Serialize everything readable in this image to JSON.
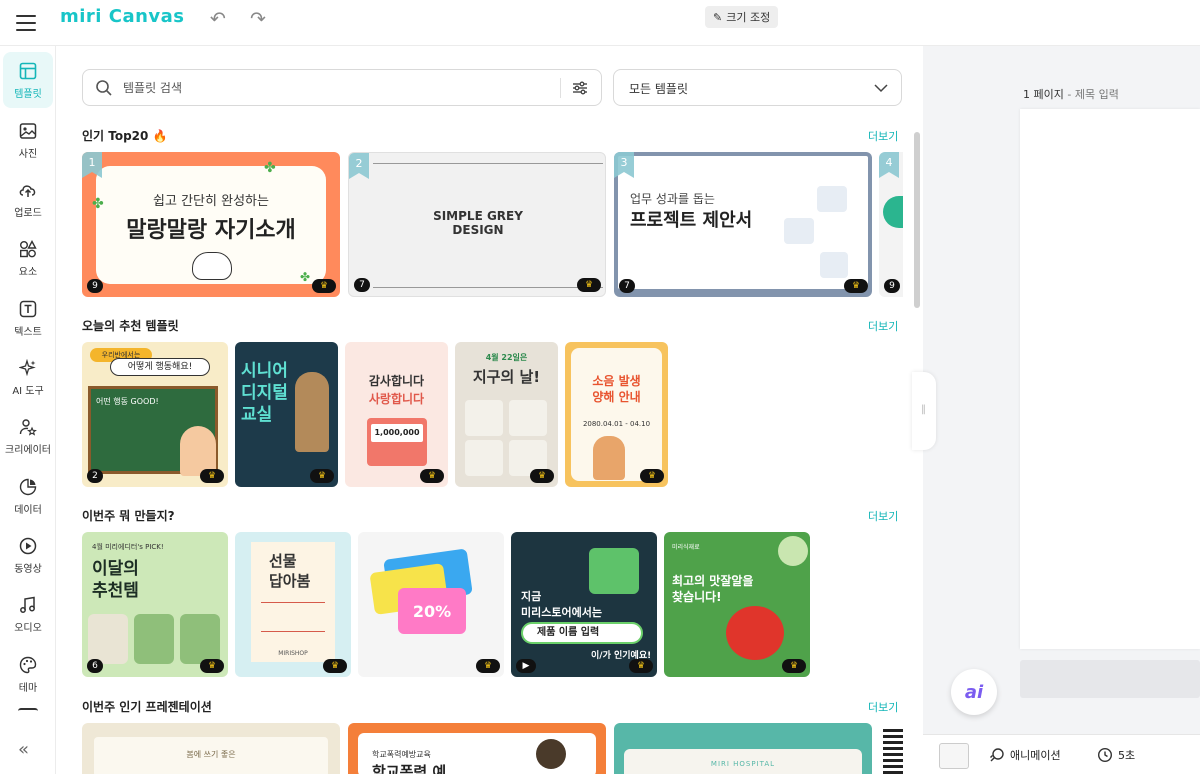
{
  "app": {
    "logo": "miri Canvas",
    "resize_label": "크기 조정"
  },
  "sidebar": {
    "items": [
      {
        "label": "템플릿"
      },
      {
        "label": "사진"
      },
      {
        "label": "업로드"
      },
      {
        "label": "요소"
      },
      {
        "label": "텍스트"
      },
      {
        "label": "AI 도구"
      },
      {
        "label": "크리에이터"
      },
      {
        "label": "데이터"
      },
      {
        "label": "동영상"
      },
      {
        "label": "오디오"
      },
      {
        "label": "테마"
      }
    ]
  },
  "search": {
    "placeholder": "템플릿 검색",
    "filter_value": "모든 템플릿"
  },
  "sections": {
    "top20": {
      "title": "인기 Top20 🔥",
      "more": "더보기"
    },
    "today": {
      "title": "오늘의 추천 템플릿",
      "more": "더보기"
    },
    "week_make": {
      "title": "이번주 뭐 만들지?",
      "more": "더보기"
    },
    "week_pres": {
      "title": "이번주 인기 프레젠테이션",
      "more": "더보기"
    }
  },
  "top20_cards": [
    {
      "rank": "1",
      "count": "9",
      "line1": "쉽고 간단히 완성하는",
      "line2": "말랑말랑 자기소개"
    },
    {
      "rank": "2",
      "count": "7",
      "line1": "SIMPLE GREY",
      "line2": "DESIGN"
    },
    {
      "rank": "3",
      "count": "7",
      "line1": "업무 성과를 돕는",
      "line2": "프로젝트 제안서"
    },
    {
      "rank": "4",
      "count": "9"
    }
  ],
  "today_cards": [
    {
      "count": "2",
      "line1": "우리반에서는",
      "line2": "어떻게 행동해요!",
      "line3": "어떤 행동 GOOD!"
    },
    {
      "line1": "시니어",
      "line2": "디지털",
      "line3": "교실"
    },
    {
      "line1": "감사합니다",
      "line2": "사랑합니다",
      "line3": "1,000,000"
    },
    {
      "line1": "4월 22일은",
      "line2": "지구의 날!"
    },
    {
      "line1": "소음 발생",
      "line2": "양해 안내",
      "line3": "2080.04.01 - 04.10"
    }
  ],
  "week_cards": [
    {
      "count": "6",
      "line1": "4월 미리에디터's PICK!",
      "line2": "이달의",
      "line3": "추천템"
    },
    {
      "line1": "선물",
      "line2": "답아봄",
      "line3": "MIRISHOP"
    },
    {
      "line1": "20%"
    },
    {
      "line1": "지금",
      "line2": "미리스토어에서는",
      "line3": "제품 이름 입력",
      "line4": "이/가 인기예요!"
    },
    {
      "line1": "미리식재료",
      "line2": "최고의 맛잘알을",
      "line3": "찾습니다!"
    }
  ],
  "pres_cards": [
    {
      "line1": "봄에 쓰기 좋은"
    },
    {
      "line1": "학교폭력예방교육",
      "line2": "학교폭력 예"
    },
    {
      "line1": "MIRI HOSPITAL"
    }
  ],
  "canvas": {
    "page_num": "1 페이지",
    "separator": "-",
    "title_placeholder": "제목 입력",
    "ai_label": "ai",
    "animation_label": "애니메이션",
    "duration_label": "5초"
  }
}
